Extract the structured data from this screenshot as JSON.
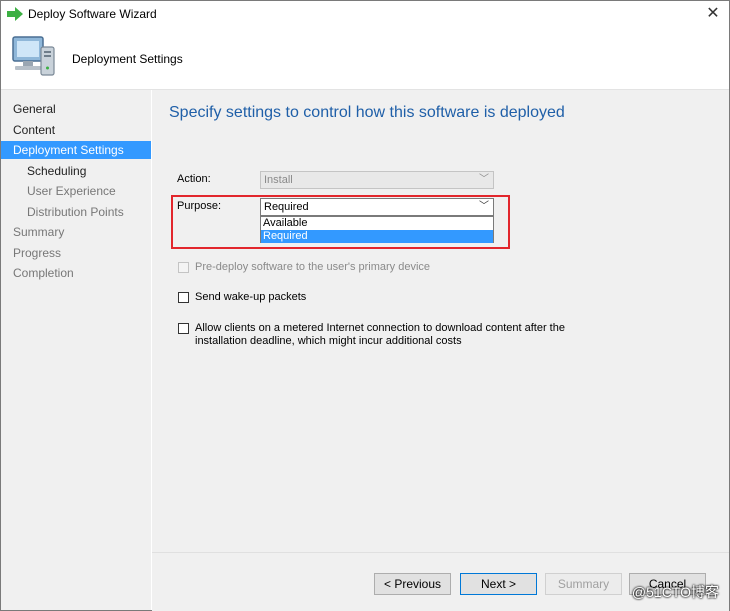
{
  "window": {
    "title": "Deploy Software Wizard",
    "close_glyph": "✕"
  },
  "header": {
    "title": "Deployment Settings"
  },
  "sidebar": {
    "items": [
      {
        "label": "General",
        "level": 0,
        "state": "normal"
      },
      {
        "label": "Content",
        "level": 0,
        "state": "normal"
      },
      {
        "label": "Deployment Settings",
        "level": 0,
        "state": "active"
      },
      {
        "label": "Scheduling",
        "level": 1,
        "state": "normal"
      },
      {
        "label": "User Experience",
        "level": 1,
        "state": "disabled"
      },
      {
        "label": "Distribution Points",
        "level": 1,
        "state": "disabled"
      },
      {
        "label": "Summary",
        "level": 0,
        "state": "disabled"
      },
      {
        "label": "Progress",
        "level": 0,
        "state": "disabled"
      },
      {
        "label": "Completion",
        "level": 0,
        "state": "disabled"
      }
    ]
  },
  "main": {
    "heading": "Specify settings to control how this software is deployed",
    "action": {
      "label": "Action:",
      "value": "Install",
      "disabled": true
    },
    "purpose": {
      "label": "Purpose:",
      "value": "Required",
      "options": [
        "Available",
        "Required"
      ],
      "selected": "Required"
    },
    "checkboxes": {
      "predeploy": {
        "label": "Pre-deploy software to the user's primary device",
        "checked": false,
        "disabled": true
      },
      "wakeup": {
        "label": "Send wake-up packets",
        "checked": false,
        "disabled": false
      },
      "metered": {
        "label_line1": "Allow clients on a metered Internet connection to download content after the",
        "label_line2": "installation deadline, which might incur additional costs",
        "checked": false,
        "disabled": false
      }
    }
  },
  "footer": {
    "previous_label": "< Previous",
    "next_label": "Next >",
    "summary_label": "Summary",
    "cancel_label": "Cancel"
  },
  "watermark": "@51CTO博客",
  "colors": {
    "accent": "#3399ff",
    "heading": "#1f5fa8",
    "highlight_box": "#e2262c",
    "title_arrow": "#3cb043"
  },
  "icons": {
    "title": "green-arrow-icon",
    "header": "computer-icon",
    "dropdown": "chevron-down-icon"
  }
}
